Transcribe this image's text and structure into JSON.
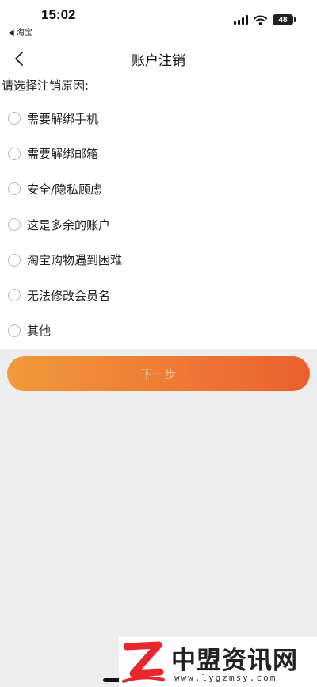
{
  "status_bar": {
    "time": "15:02",
    "back_app": "◀ 淘宝",
    "battery": "48"
  },
  "nav": {
    "title": "账户注销"
  },
  "prompt": "请选择注销原因:",
  "options": [
    {
      "label": "需要解绑手机"
    },
    {
      "label": "需要解绑邮箱"
    },
    {
      "label": "安全/隐私顾虑"
    },
    {
      "label": "这是多余的账户"
    },
    {
      "label": "淘宝购物遇到困难"
    },
    {
      "label": "无法修改会员名"
    },
    {
      "label": "其他"
    }
  ],
  "next_button": "下一步",
  "watermark": {
    "name": "中盟资讯网",
    "url": "www.lygzmsy.com"
  }
}
